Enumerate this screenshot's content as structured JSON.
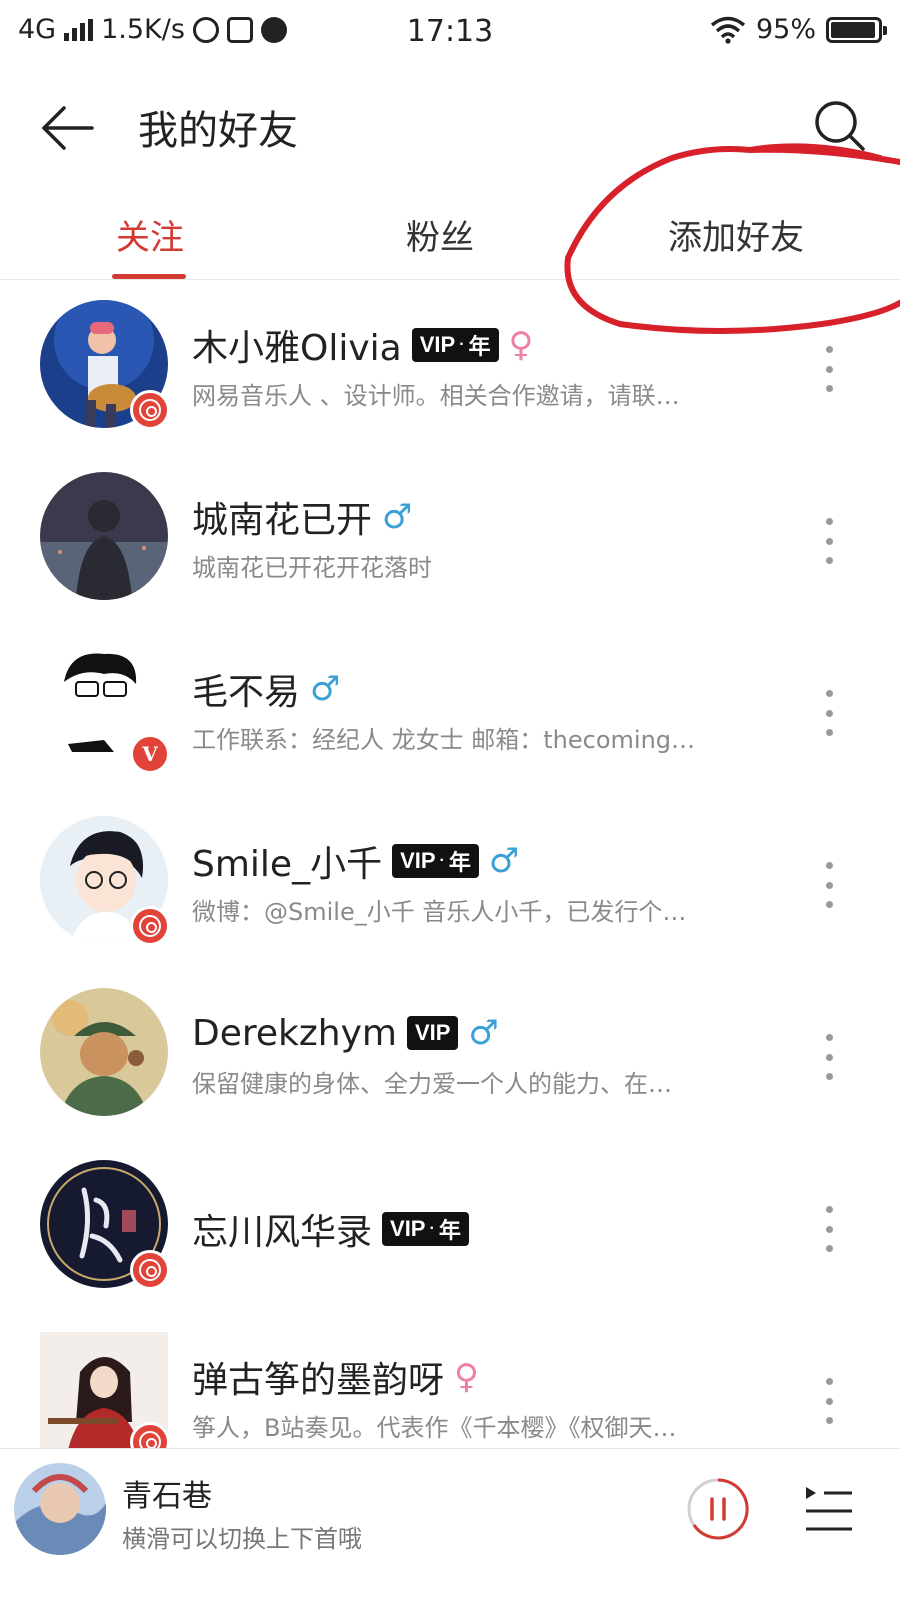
{
  "status_bar": {
    "network": "4G",
    "speed": "1.5K/s",
    "time": "17:13",
    "battery": "95%"
  },
  "header": {
    "title": "我的好友"
  },
  "tabs": [
    {
      "label": "关注",
      "active": true
    },
    {
      "label": "粉丝",
      "active": false
    },
    {
      "label": "添加好友",
      "active": false
    }
  ],
  "vip_text": "VIP",
  "vip_year": "年",
  "male_symbol": "♂",
  "female_symbol": "♀",
  "friends": [
    {
      "name": "木小雅Olivia",
      "vip": "year",
      "gender": "female",
      "badge": "music",
      "desc": "网易音乐人 、设计师。相关合作邀请，请联…"
    },
    {
      "name": "城南花已开",
      "vip": "none",
      "gender": "male",
      "badge": "none",
      "desc": "城南花已开花开花落时"
    },
    {
      "name": "毛不易",
      "vip": "none",
      "gender": "male",
      "badge": "v",
      "desc": "工作联系：经纪人 龙女士 邮箱：thecoming…"
    },
    {
      "name": "Smile_小千",
      "vip": "year",
      "gender": "male",
      "badge": "music",
      "desc": "微博：@Smile_小千 音乐人小千，已发行个…"
    },
    {
      "name": "Derekzhym",
      "vip": "plain",
      "gender": "male",
      "badge": "none",
      "desc": "保留健康的身体、全力爱一个人的能力、在…"
    },
    {
      "name": "忘川风华录",
      "vip": "year",
      "gender": "none",
      "badge": "music",
      "desc": ""
    },
    {
      "name": "弹古筝的墨韵呀",
      "vip": "none",
      "gender": "female",
      "badge": "music",
      "desc": "筝人，B站奏见。代表作《千本樱》《权御天…"
    }
  ],
  "badge_v_letter": "V",
  "player": {
    "title": "青石巷",
    "subtitle": "横滑可以切换上下首哦"
  },
  "colors": {
    "accent": "#d33a31",
    "male": "#3aa0d8",
    "female": "#ef7fa8",
    "annotation": "#d8202a"
  }
}
